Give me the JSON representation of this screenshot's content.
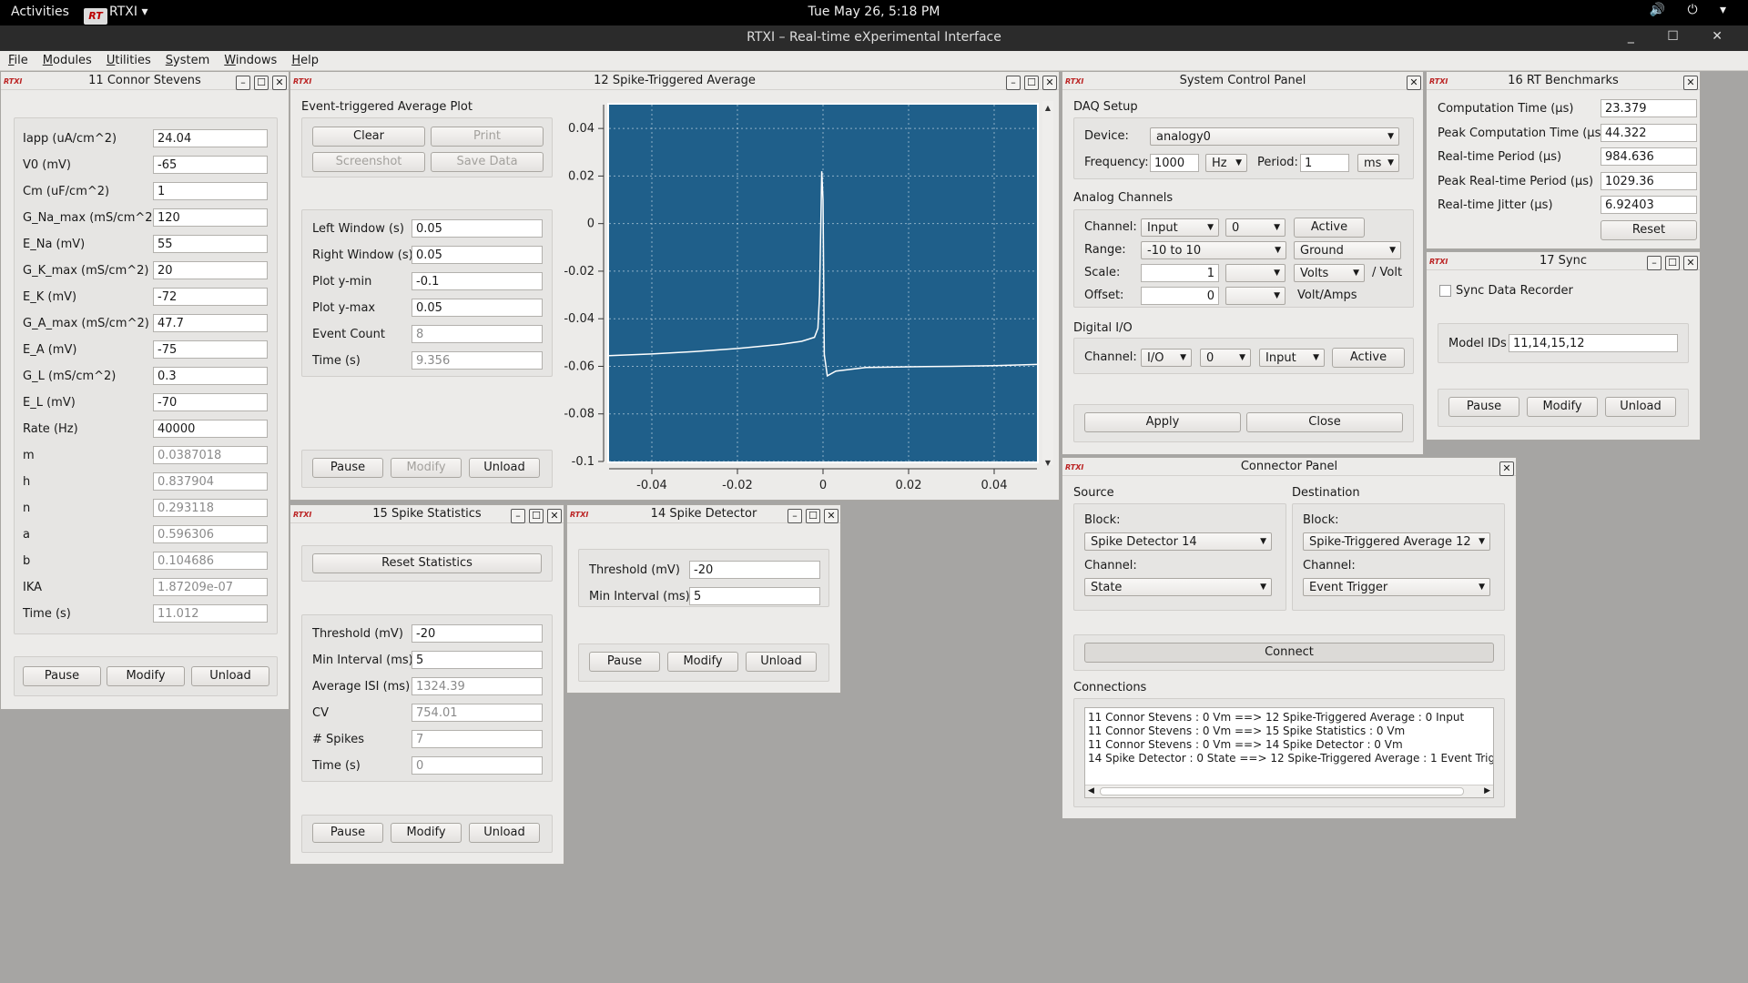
{
  "topbar": {
    "activities": "Activities",
    "app_logo": "RT",
    "app_name": "RTXI",
    "app_arrow": "▾",
    "clock": "Tue May 26,  5:18 PM",
    "tray_icons": "🔊 ⏻ ▾"
  },
  "maintitle": {
    "title": "RTXI – Real-time eXperimental Interface",
    "controls": "_ ☐ ✕"
  },
  "menu": {
    "items": [
      "File",
      "Modules",
      "Utilities",
      "System",
      "Windows",
      "Help"
    ]
  },
  "rtxi_badge": "RTXI",
  "icons": {
    "minimize": "–",
    "maximize": "☐",
    "close": "✕",
    "dropdown": "▼",
    "left": "◀",
    "right": "▶",
    "up": "▲",
    "down": "▼"
  },
  "connor": {
    "title": "11 Connor Stevens",
    "params": [
      {
        "label": "Iapp (uA/cm^2)",
        "value": "24.04",
        "ro": false
      },
      {
        "label": "V0 (mV)",
        "value": "-65",
        "ro": false
      },
      {
        "label": "Cm (uF/cm^2)",
        "value": "1",
        "ro": false
      },
      {
        "label": "G_Na_max (mS/cm^2)",
        "value": "120",
        "ro": false
      },
      {
        "label": "E_Na (mV)",
        "value": "55",
        "ro": false
      },
      {
        "label": "G_K_max (mS/cm^2)",
        "value": "20",
        "ro": false
      },
      {
        "label": "E_K (mV)",
        "value": "-72",
        "ro": false
      },
      {
        "label": "G_A_max (mS/cm^2)",
        "value": "47.7",
        "ro": false
      },
      {
        "label": "E_A (mV)",
        "value": "-75",
        "ro": false
      },
      {
        "label": "G_L (mS/cm^2)",
        "value": "0.3",
        "ro": false
      },
      {
        "label": "E_L (mV)",
        "value": "-70",
        "ro": false
      },
      {
        "label": "Rate (Hz)",
        "value": "40000",
        "ro": false
      },
      {
        "label": "m",
        "value": "0.0387018",
        "ro": true
      },
      {
        "label": "h",
        "value": "0.837904",
        "ro": true
      },
      {
        "label": "n",
        "value": "0.293118",
        "ro": true
      },
      {
        "label": "a",
        "value": "0.596306",
        "ro": true
      },
      {
        "label": "b",
        "value": "0.104686",
        "ro": true
      },
      {
        "label": "IKA",
        "value": "1.87209e-07",
        "ro": true
      },
      {
        "label": "Time (s)",
        "value": "11.012",
        "ro": true
      }
    ],
    "pause": "Pause",
    "modify": "Modify",
    "unload": "Unload"
  },
  "sta": {
    "title": "12 Spike-Triggered Average",
    "group_title": "Event-triggered Average Plot",
    "clear": "Clear",
    "print": "Print",
    "screenshot": "Screenshot",
    "save_data": "Save Data",
    "params": [
      {
        "label": "Left Window (s)",
        "value": "0.05",
        "ro": false
      },
      {
        "label": "Right Window (s)",
        "value": "0.05",
        "ro": false
      },
      {
        "label": "Plot y-min",
        "value": "-0.1",
        "ro": false
      },
      {
        "label": "Plot y-max",
        "value": "0.05",
        "ro": false
      },
      {
        "label": "Event Count",
        "value": "8",
        "ro": true
      },
      {
        "label": "Time (s)",
        "value": "9.356",
        "ro": true
      }
    ],
    "pause": "Pause",
    "modify": "Modify",
    "unload": "Unload"
  },
  "chart_data": {
    "type": "line",
    "xlim": [
      -0.05,
      0.05
    ],
    "ylim": [
      -0.1,
      0.05
    ],
    "x_ticks": [
      "-0.04",
      "-0.02",
      "0",
      "0.02",
      "0.04"
    ],
    "x_tick_values": [
      -0.04,
      -0.02,
      0,
      0.02,
      0.04
    ],
    "y_ticks": [
      "0.04",
      "0.02",
      "0",
      "-0.02",
      "-0.04",
      "-0.06",
      "-0.08",
      "-0.1"
    ],
    "y_tick_values": [
      0.04,
      0.02,
      0,
      -0.02,
      -0.04,
      -0.06,
      -0.08,
      -0.1
    ],
    "grid": true,
    "series": [
      {
        "x": [
          -0.05,
          -0.04,
          -0.03,
          -0.02,
          -0.01,
          -0.005,
          -0.002,
          -0.0012,
          -0.0008,
          -0.0005,
          -0.0003,
          0.0,
          0.0003,
          0.001,
          0.003,
          0.01,
          0.02,
          0.03,
          0.04,
          0.05
        ],
        "y": [
          -0.0555,
          -0.0548,
          -0.0538,
          -0.0525,
          -0.0508,
          -0.0495,
          -0.0478,
          -0.044,
          -0.03,
          0.0,
          0.022,
          0.01,
          -0.055,
          -0.064,
          -0.062,
          -0.0605,
          -0.0602,
          -0.06,
          -0.0597,
          -0.0592
        ]
      }
    ],
    "line_color": "#ffffff",
    "bg_color": "#1f5f8a"
  },
  "stats": {
    "title": "15 Spike Statistics",
    "reset": "Reset Statistics",
    "params": [
      {
        "label": "Threshold (mV)",
        "value": "-20",
        "ro": false
      },
      {
        "label": "Min Interval (ms)",
        "value": "5",
        "ro": false
      },
      {
        "label": "Average ISI (ms)",
        "value": "1324.39",
        "ro": true
      },
      {
        "label": "CV",
        "value": "754.01",
        "ro": true
      },
      {
        "label": "# Spikes",
        "value": "7",
        "ro": true
      },
      {
        "label": "Time (s)",
        "value": "0",
        "ro": true
      }
    ],
    "pause": "Pause",
    "modify": "Modify",
    "unload": "Unload"
  },
  "detector": {
    "title": "14 Spike Detector",
    "params": [
      {
        "label": "Threshold (mV)",
        "value": "-20"
      },
      {
        "label": "Min Interval (ms)",
        "value": "5"
      }
    ],
    "pause": "Pause",
    "modify": "Modify",
    "unload": "Unload"
  },
  "scp": {
    "title": "System Control Panel",
    "daq_title": "DAQ Setup",
    "device_label": "Device:",
    "device": "analogy0",
    "freq_label": "Frequency:",
    "freq": "1000",
    "freq_unit": "Hz",
    "period_label": "Period:",
    "period": "1",
    "period_unit": "ms",
    "analog_title": "Analog Channels",
    "channel_label": "Channel:",
    "a_channel_type": "Input",
    "a_channel_num": "0",
    "a_active": "Active",
    "range_label": "Range:",
    "range": "-10 to 10",
    "reference": "Ground",
    "scale_label": "Scale:",
    "scale": "1",
    "scale_prefix": "",
    "scale_unit": "Volts",
    "per_volt": "/ Volt",
    "offset_label": "Offset:",
    "offset": "0",
    "offset_prefix": "",
    "offset_unit": "Volt/Amps",
    "digital_title": "Digital I/O",
    "d_channel_type": "I/O",
    "d_channel_num": "0",
    "d_direction": "Input",
    "d_active": "Active",
    "apply": "Apply",
    "close": "Close"
  },
  "bench": {
    "title": "16 RT Benchmarks",
    "rows": [
      {
        "label": "Computation Time (µs)",
        "value": "23.379"
      },
      {
        "label": "Peak Computation Time (µs)",
        "value": "44.322"
      },
      {
        "label": "Real-time Period (µs)",
        "value": "984.636"
      },
      {
        "label": "Peak Real-time Period (µs)",
        "value": "1029.36"
      },
      {
        "label": "Real-time Jitter (µs)",
        "value": "6.92403"
      }
    ],
    "reset": "Reset"
  },
  "sync": {
    "title": "17 Sync",
    "sync_label": "Sync Data Recorder",
    "model_ids_label": "Model IDs",
    "model_ids": "11,14,15,12",
    "pause": "Pause",
    "modify": "Modify",
    "unload": "Unload"
  },
  "connector": {
    "title": "Connector Panel",
    "source_title": "Source",
    "dest_title": "Destination",
    "block_label": "Block:",
    "channel_label": "Channel:",
    "src_block": "Spike Detector 14",
    "src_channel": "State",
    "dst_block": "Spike-Triggered Average 12",
    "dst_channel": "Event Trigger",
    "connect": "Connect",
    "connections_title": "Connections",
    "connections": [
      "11 Connor Stevens : 0 Vm ==> 12 Spike-Triggered Average : 0 Input",
      "11 Connor Stevens : 0 Vm ==> 15 Spike Statistics : 0 Vm",
      "11 Connor Stevens : 0 Vm ==> 14 Spike Detector : 0 Vm",
      "14 Spike Detector : 0 State ==> 12 Spike-Triggered Average : 1 Event Trig"
    ]
  }
}
